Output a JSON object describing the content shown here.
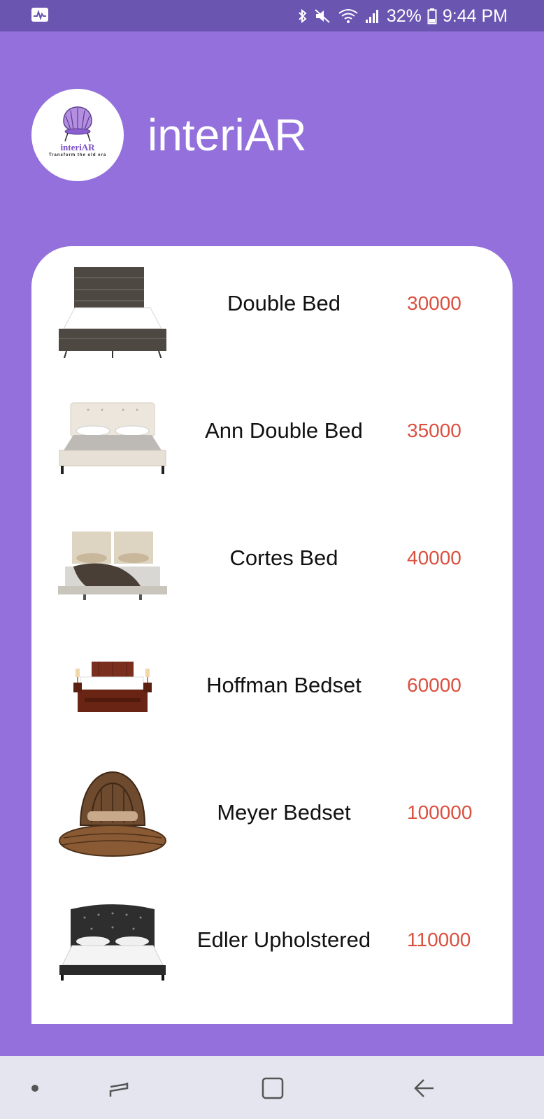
{
  "status_bar": {
    "battery_percent": "32%",
    "time": "9:44 PM"
  },
  "header": {
    "title": "interiAR",
    "logo": {
      "name": "interiAR",
      "tagline": "Transform the old era"
    }
  },
  "products": [
    {
      "name": "Double Bed",
      "price": "30000",
      "image": "double-bed-image"
    },
    {
      "name": "Ann Double Bed",
      "price": "35000",
      "image": "ann-double-bed-image"
    },
    {
      "name": "Cortes Bed",
      "price": "40000",
      "image": "cortes-bed-image"
    },
    {
      "name": "Hoffman Bedset",
      "price": "60000",
      "image": "hoffman-bedset-image"
    },
    {
      "name": "Meyer Bedset",
      "price": "100000",
      "image": "meyer-bedset-image"
    },
    {
      "name": "Edler Upholstered",
      "price": "110000",
      "image": "edler-upholstered-image"
    }
  ],
  "nav": [
    "recent-apps-icon",
    "home-icon",
    "back-icon"
  ],
  "colors": {
    "background": "#9370db",
    "status_bar": "#6a55b0",
    "price": "#d9503f",
    "nav_bar": "#e5e5f0"
  }
}
